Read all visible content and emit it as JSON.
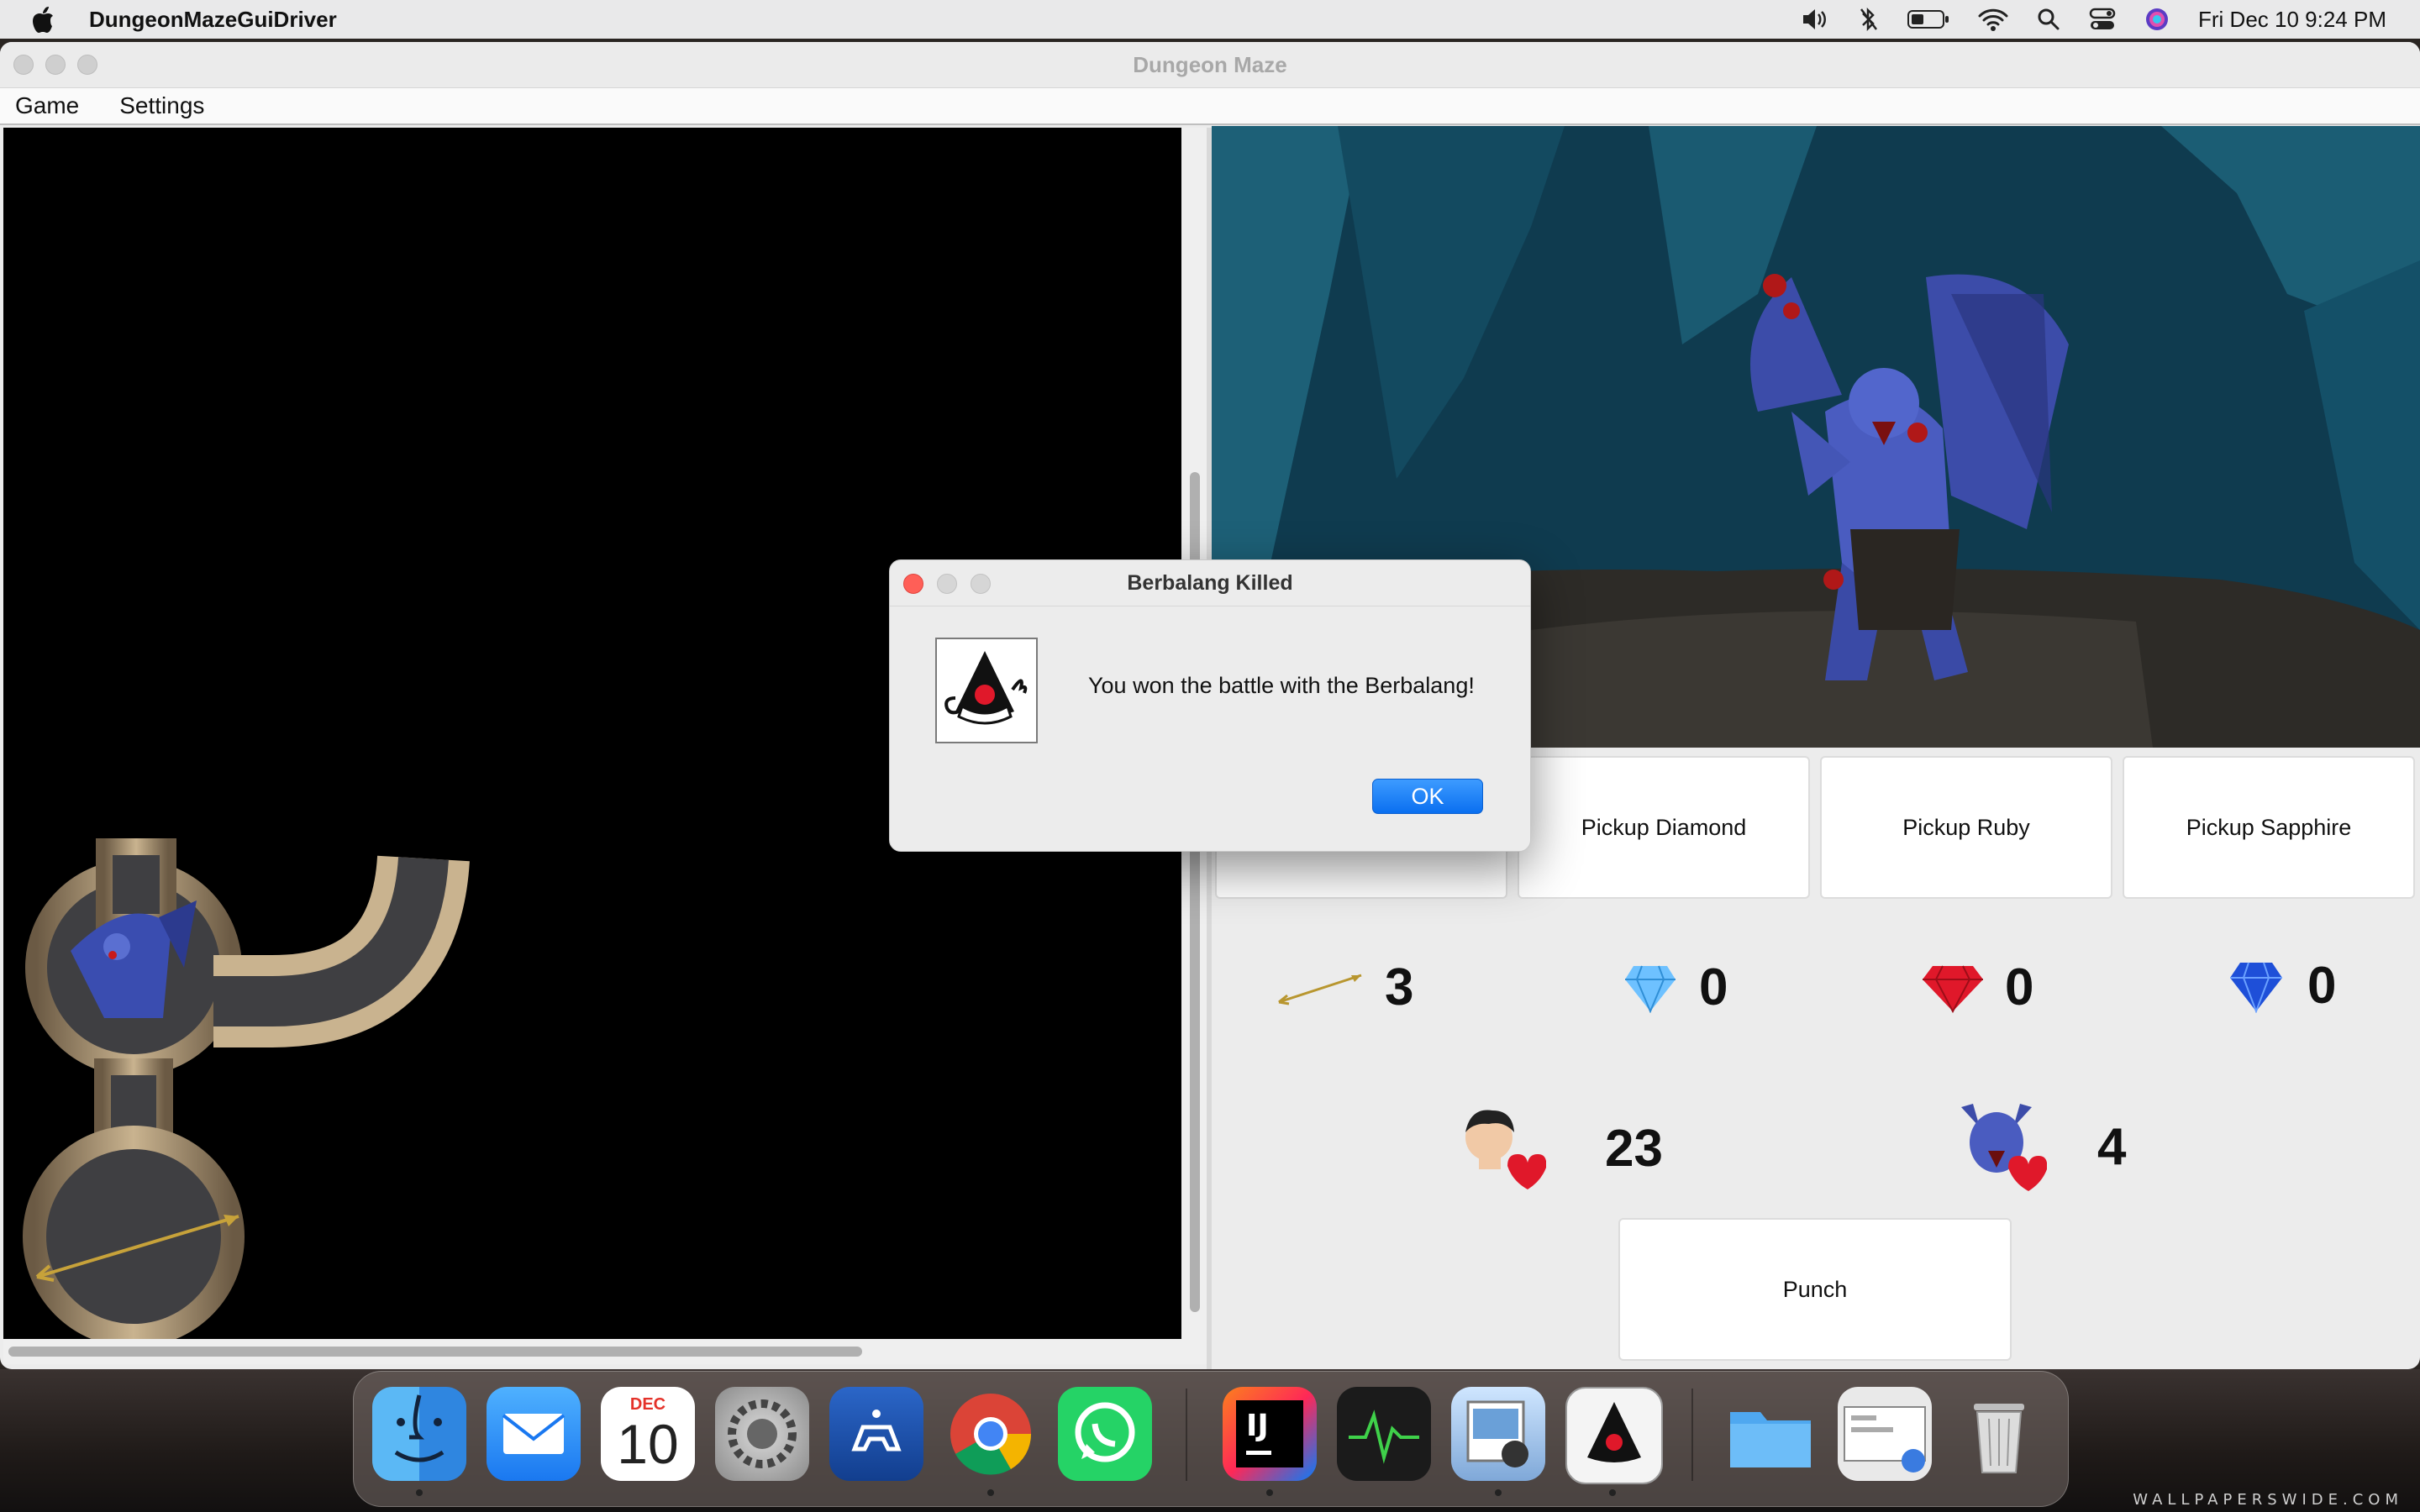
{
  "menubar": {
    "app_name": "DungeonMazeGuiDriver",
    "clock": "Fri Dec 10  9:24 PM"
  },
  "window": {
    "title": "Dungeon Maze",
    "menus": [
      "Game",
      "Settings"
    ]
  },
  "actions": {
    "pickup_diamond": "Pickup Diamond",
    "pickup_ruby": "Pickup Ruby",
    "pickup_sapphire": "Pickup Sapphire",
    "punch": "Punch"
  },
  "inventory": {
    "arrows": "3",
    "diamonds": "0",
    "rubies": "0",
    "sapphires": "0"
  },
  "health": {
    "hero": "23",
    "monster": "4"
  },
  "dialog": {
    "title": "Berbalang Killed",
    "message": "You won the battle with the Berbalang!",
    "ok_label": "OK"
  },
  "dock": {
    "calendar_month": "DEC",
    "calendar_day": "10",
    "items": [
      "finder-icon",
      "mail-icon",
      "calendar-icon",
      "system-preferences-icon",
      "controller-app-icon",
      "chrome-icon",
      "whatsapp-icon",
      "intellij-icon",
      "activity-monitor-icon",
      "preview-icon",
      "java-icon",
      "downloads-folder-icon",
      "screenshot-stack-icon",
      "trash-icon"
    ]
  },
  "wallpaper_credit": "WALLPAPERSWIDE.COM",
  "colors": {
    "accent": "#0a6ff0",
    "close": "#ff5f57",
    "ruby": "#e0182a",
    "diamond": "#6ec1ff",
    "sapphire": "#1e4fd8"
  }
}
